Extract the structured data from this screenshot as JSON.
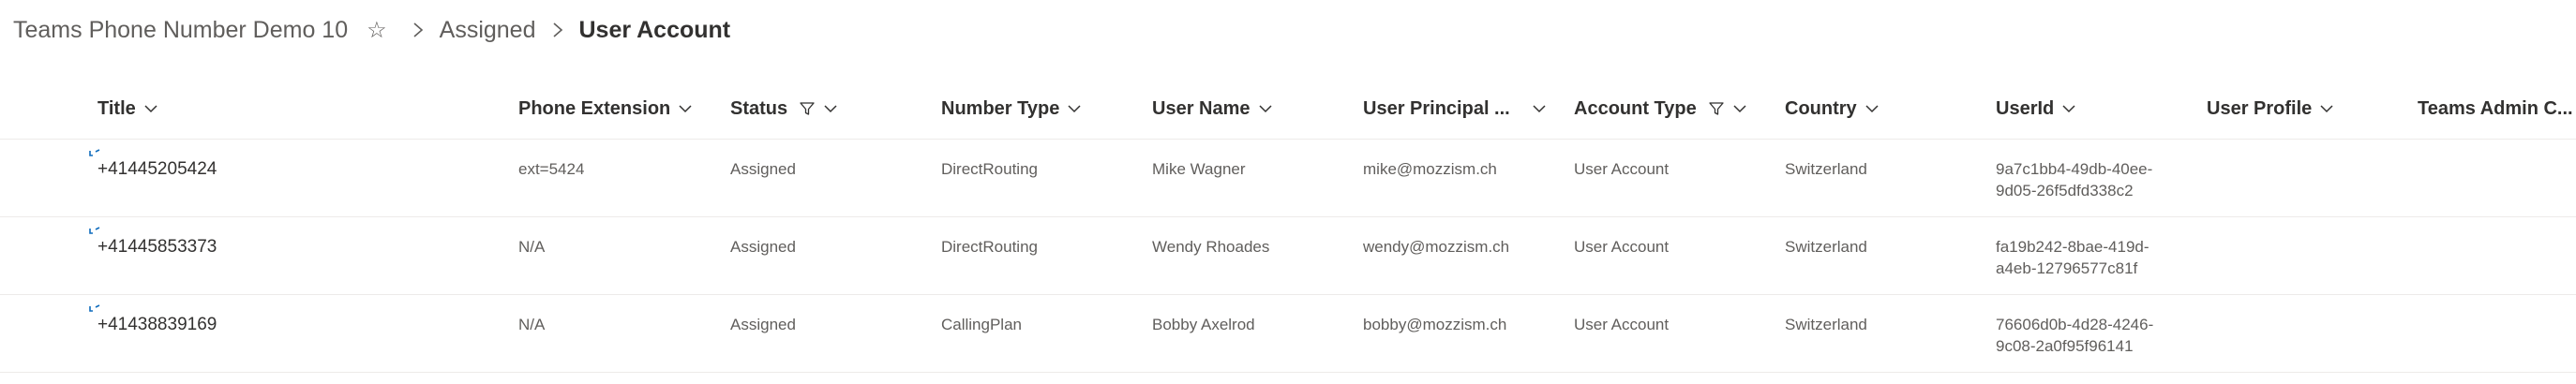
{
  "breadcrumb": {
    "list_name": "Teams Phone Number Demo 10",
    "folder": "Assigned",
    "current_view": "User Account"
  },
  "icons": {
    "favorite": "star-icon",
    "separator": "chevron-right-icon",
    "column_menu": "chevron-down-icon",
    "filter": "filter-icon",
    "new_item": "new-item-sparkle-icon"
  },
  "colors": {
    "accent": "#0f6cbd",
    "text": "#323130",
    "subtle_text": "#605e5c",
    "divider": "#edebe9"
  },
  "columns": {
    "title": "Title",
    "phone_extension": "Phone Extension",
    "status": "Status",
    "number_type": "Number Type",
    "user_name": "User Name",
    "user_principal": "User Principal ...",
    "account_type": "Account Type",
    "country": "Country",
    "userid": "UserId",
    "user_profile": "User Profile",
    "teams_admin": "Teams Admin C..."
  },
  "rows": [
    {
      "title": "+41445205424",
      "phone_extension": "ext=5424",
      "status": "Assigned",
      "number_type": "DirectRouting",
      "user_name": "Mike Wagner",
      "user_principal": "mike@mozzism.ch",
      "account_type": "User Account",
      "country": "Switzerland",
      "userid": "9a7c1bb4-49db-40ee-9d05-26f5dfd338c2",
      "user_profile": "",
      "teams_admin": ""
    },
    {
      "title": "+41445853373",
      "phone_extension": "N/A",
      "status": "Assigned",
      "number_type": "DirectRouting",
      "user_name": "Wendy Rhoades",
      "user_principal": "wendy@mozzism.ch",
      "account_type": "User Account",
      "country": "Switzerland",
      "userid": "fa19b242-8bae-419d-a4eb-12796577c81f",
      "user_profile": "",
      "teams_admin": ""
    },
    {
      "title": "+41438839169",
      "phone_extension": "N/A",
      "status": "Assigned",
      "number_type": "CallingPlan",
      "user_name": "Bobby Axelrod",
      "user_principal": "bobby@mozzism.ch",
      "account_type": "User Account",
      "country": "Switzerland",
      "userid": "76606d0b-4d28-4246-9c08-2a0f95f96141",
      "user_profile": "",
      "teams_admin": ""
    }
  ]
}
